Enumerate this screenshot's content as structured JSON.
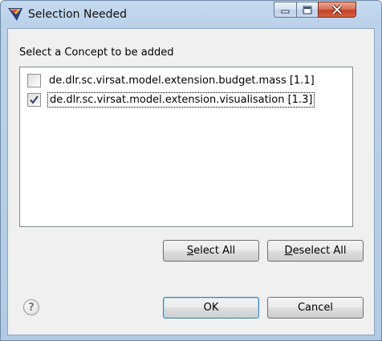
{
  "window": {
    "title": "Selection Needed",
    "app_icon": "eclipse-app-icon",
    "caption_buttons": [
      "minimize-icon",
      "maximize-icon",
      "close-icon"
    ]
  },
  "dialog": {
    "prompt": "Select a Concept to be added",
    "items": [
      {
        "label": "de.dlr.sc.virsat.model.extension.budget.mass [1.1]",
        "checked": false,
        "focused": false
      },
      {
        "label": "de.dlr.sc.virsat.model.extension.visualisation [1.3]",
        "checked": true,
        "focused": true
      }
    ],
    "buttons": {
      "select_all": {
        "mnemonic": "S",
        "rest": "elect All"
      },
      "deselect_all": {
        "mnemonic": "D",
        "rest": "eselect All"
      },
      "ok": "OK",
      "cancel": "Cancel"
    },
    "help_icon": "help-icon",
    "help_glyph": "?"
  }
}
